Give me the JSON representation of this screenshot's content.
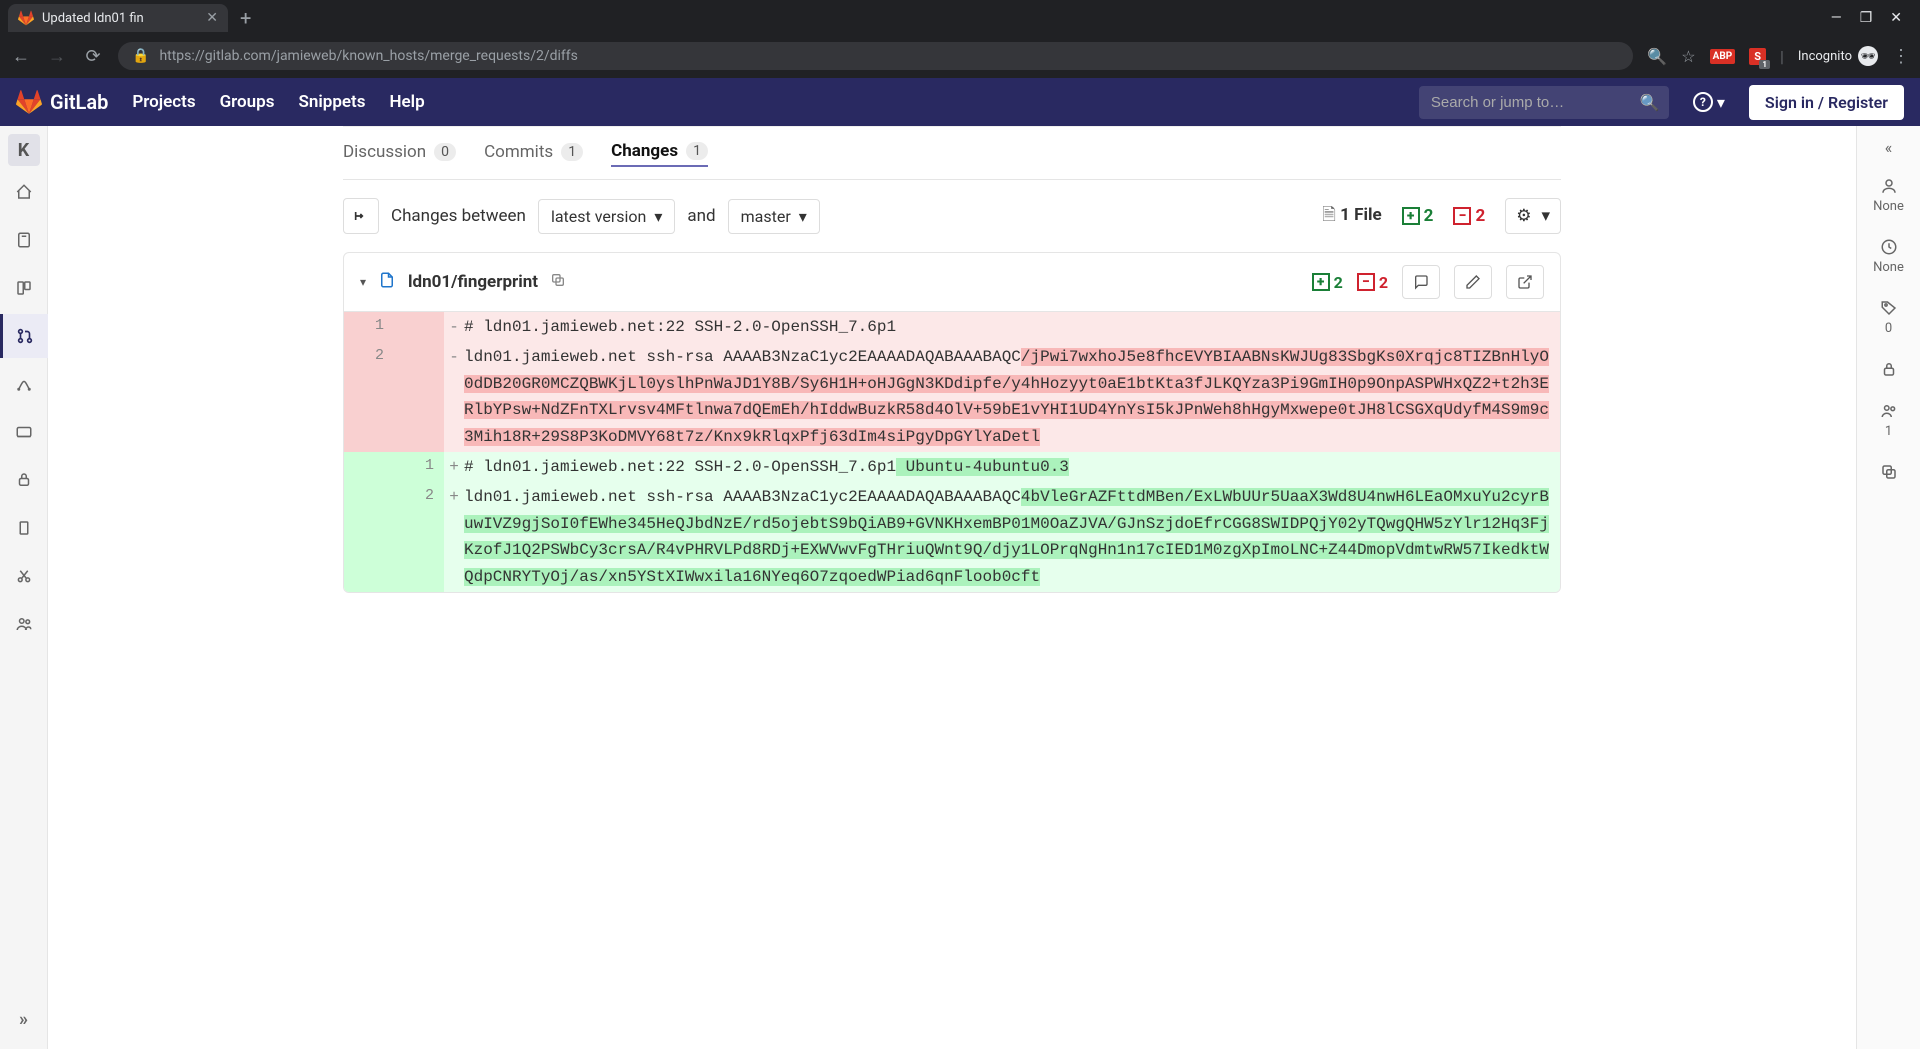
{
  "browser": {
    "tab_title": "Updated ldn01 fin",
    "url": "https://gitlab.com/jamieweb/known_hosts/merge_requests/2/diffs",
    "incognito_label": "Incognito"
  },
  "nav": {
    "brand": "GitLab",
    "links": {
      "projects": "Projects",
      "groups": "Groups",
      "snippets": "Snippets",
      "help": "Help"
    },
    "search_placeholder": "Search or jump to…",
    "signin": "Sign in / Register"
  },
  "left_rail": {
    "project_initial": "K"
  },
  "tabs": {
    "discussion": {
      "label": "Discussion",
      "count": "0"
    },
    "commits": {
      "label": "Commits",
      "count": "1"
    },
    "changes": {
      "label": "Changes",
      "count": "1"
    }
  },
  "compare": {
    "label_between": "Changes between",
    "version": "latest version",
    "and": "and",
    "target": "master",
    "files_label": "1 File",
    "additions": "2",
    "deletions": "2"
  },
  "diff_file": {
    "path": "ldn01/fingerprint",
    "additions": "2",
    "deletions": "2"
  },
  "diff_lines": {
    "r1_old": "1",
    "r1_code": "# ldn01.jamieweb.net:22 SSH-2.0-OpenSSH_7.6p1",
    "r2_old": "2",
    "r2_prefix": "ldn01.jamieweb.net ssh-rsa AAAAB3NzaC1yc2EAAAADAQABAAABAQC",
    "r2_hl": "/jPwi7wxhoJ5e8fhcEVYBIAABNsKWJUg83SbgKs0Xrqjc8TIZBnHlyO0dDB20GR0MCZQBWKjLl0yslhPnWaJD1Y8B/Sy6H1H+oHJGgN3KDdipfe/y4hHozyyt0aE1btKta3fJLKQYza3Pi9GmIH0p9OnpASPWHxQZ2+t2h3ERlbYPsw+NdZFnTXLrvsv4MFtlnwa7dQEmEh/hIddwBuzkR58d4OlV+59bE1vYHI1UD4YnYsI5kJPnWeh8hHgyMxwepe0tJH8lCSGXqUdyfM4S9m9c3Mih18R+29S8P3KoDMVY68t7z/Knx9kRlqxPfj63dIm4siPgyDpGYlYaDetl",
    "a1_new": "1",
    "a1_prefix": "# ldn01.jamieweb.net:22 SSH-2.0-OpenSSH_7.6p1",
    "a1_hl": " Ubuntu-4ubuntu0.3",
    "a2_new": "2",
    "a2_prefix": "ldn01.jamieweb.net ssh-rsa AAAAB3NzaC1yc2EAAAADAQABAAABAQC",
    "a2_hl": "4bVleGrAZFttdMBen/ExLWbUUr5UaaX3Wd8U4nwH6LEaOMxuYu2cyrBuwIVZ9gjSoI0fEWhe345HeQJbdNzE/rd5ojebtS9bQiAB9+GVNKHxemBP01M0OaZJVA/GJnSzjdoEfrCGG8SWIDPQjY02yTQwgQHW5zYlr12Hq3FjKzofJ1Q2PSWbCy3crsA/R4vPHRVLPd8RDj+EXWVwvFgTHriuQWnt9Q/djy1LOPrqNgHn1n17cIED1M0zgXpImoLNC+Z44DmopVdmtwRW57IkedktWQdpCNRYTyOj/as/xn5YStXIWwxila16NYeq6O7zqoedWPiad6qnFloob0cft"
  },
  "right_rail": {
    "assignee": "None",
    "milestone": "None",
    "labels_count": "0",
    "participants_count": "1"
  }
}
